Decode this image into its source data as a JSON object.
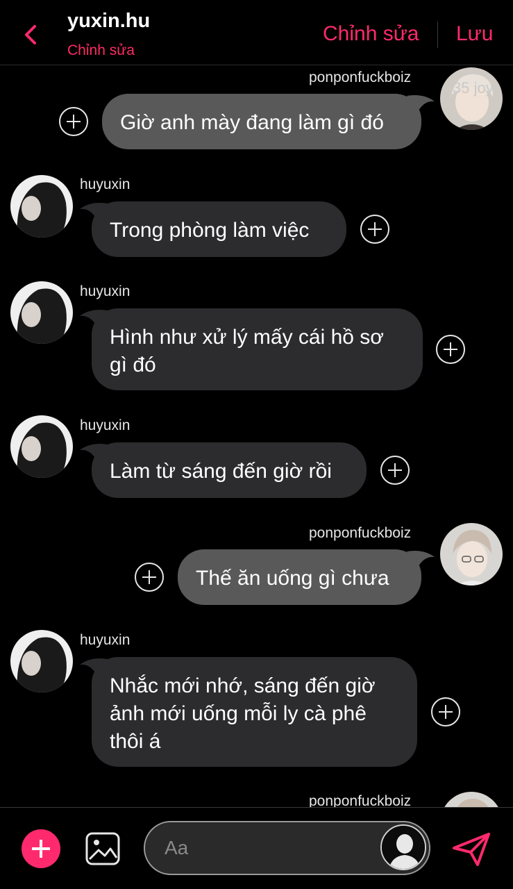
{
  "header": {
    "title": "yuxin.hu",
    "subtitle": "Chỉnh sửa",
    "edit_label": "Chỉnh sửa",
    "save_label": "Lưu"
  },
  "messages": [
    {
      "sender": "ponponfuckboiz",
      "direction": "outgoing",
      "text": "Giờ anh mày đang làm gì đó",
      "avatar_badge": "35 joy"
    },
    {
      "sender": "huyuxin",
      "direction": "incoming",
      "text": "Trong phòng làm việc"
    },
    {
      "sender": "huyuxin",
      "direction": "incoming",
      "text": "Hình như xử lý mấy cái hồ sơ gì đó"
    },
    {
      "sender": "huyuxin",
      "direction": "incoming",
      "text": "Làm từ sáng đến giờ rồi"
    },
    {
      "sender": "ponponfuckboiz",
      "direction": "outgoing",
      "text": "Thế ăn uống gì chưa"
    },
    {
      "sender": "huyuxin",
      "direction": "incoming",
      "text": "Nhắc mới nhớ, sáng đến giờ ảnh mới uống mỗi ly cà phê thôi á"
    },
    {
      "sender": "ponponfuckboiz",
      "direction": "outgoing",
      "text": ""
    }
  ],
  "composer": {
    "placeholder": "Aa",
    "add_icon": "plus-icon",
    "image_icon": "image-icon",
    "persona_icon": "person-silhouette-icon",
    "send_icon": "send-icon"
  },
  "colors": {
    "accent": "#ff2a6d",
    "subtitle": "#ff2a62",
    "outgoing_bubble": "#595959",
    "incoming_bubble": "#2c2c2e",
    "background": "#000000"
  }
}
